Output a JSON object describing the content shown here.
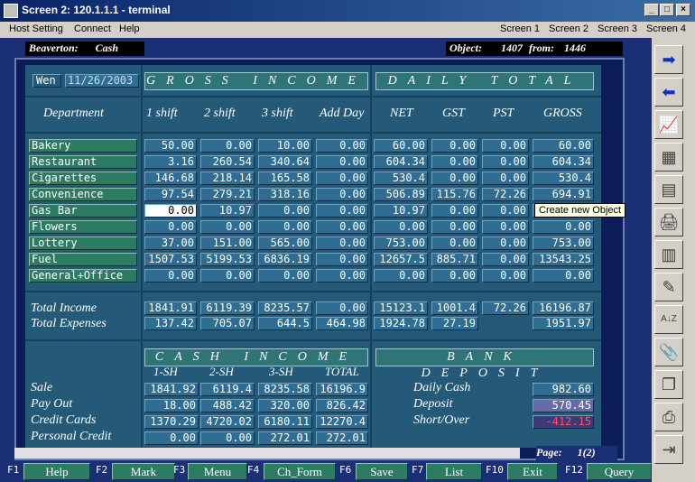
{
  "window": {
    "title": "Screen 2: 120.1.1.1 - terminal"
  },
  "menu": {
    "left": [
      "Host Setting",
      "Connect",
      "Help"
    ],
    "right": [
      "Screen 1",
      "Screen 2",
      "Screen 3",
      "Screen 4"
    ]
  },
  "header": {
    "location": "Beaverton:",
    "mode": "Cash",
    "object_label": "Object:",
    "object_id": "1407",
    "from_label": "from:",
    "from_total": "1446"
  },
  "date": {
    "day": "Wen",
    "value": "11/26/2003"
  },
  "banners": {
    "gross": "GROSS INCOME",
    "daily": "DAILY TOTAL",
    "cash": "CASH INCOME",
    "bank": "BANK DEPOSIT"
  },
  "columns": [
    "Department",
    "1 shift",
    "2 shift",
    "3 shift",
    "Add Day",
    "NET",
    "GST",
    "PST",
    "GROSS"
  ],
  "rows": [
    {
      "dept": "Bakery",
      "v": [
        "50.00",
        "0.00",
        "10.00",
        "0.00",
        "60.00",
        "0.00",
        "0.00",
        "60.00"
      ]
    },
    {
      "dept": "Restaurant",
      "v": [
        "3.16",
        "260.54",
        "340.64",
        "0.00",
        "604.34",
        "0.00",
        "0.00",
        "604.34"
      ]
    },
    {
      "dept": "Cigarettes",
      "v": [
        "146.68",
        "218.14",
        "165.58",
        "0.00",
        "530.4",
        "0.00",
        "0.00",
        "530.4"
      ]
    },
    {
      "dept": "Convenience",
      "v": [
        "97.54",
        "279.21",
        "318.16",
        "0.00",
        "506.89",
        "115.76",
        "72.26",
        "694.91"
      ]
    },
    {
      "dept": "Gas Bar",
      "v": [
        "0.00",
        "10.97",
        "0.00",
        "0.00",
        "10.97",
        "0.00",
        "0.00",
        ""
      ]
    },
    {
      "dept": "Flowers",
      "v": [
        "0.00",
        "0.00",
        "0.00",
        "0.00",
        "0.00",
        "0.00",
        "0.00",
        "0.00"
      ]
    },
    {
      "dept": "Lottery",
      "v": [
        "37.00",
        "151.00",
        "565.00",
        "0.00",
        "753.00",
        "0.00",
        "0.00",
        "753.00"
      ]
    },
    {
      "dept": "Fuel",
      "v": [
        "1507.53",
        "5199.53",
        "6836.19",
        "0.00",
        "12657.5",
        "885.71",
        "0.00",
        "13543.25"
      ]
    },
    {
      "dept": "General+Office",
      "v": [
        "0.00",
        "0.00",
        "0.00",
        "0.00",
        "0.00",
        "0.00",
        "0.00",
        "0.00"
      ]
    }
  ],
  "totals": {
    "income_label": "Total   Income",
    "income": [
      "1841.91",
      "6119.39",
      "8235.57",
      "0.00",
      "15123.1",
      "1001.4",
      "72.26",
      "16196.87"
    ],
    "expenses_label": "Total   Expenses",
    "expenses": [
      "137.42",
      "705.07",
      "644.5",
      "464.98",
      "1924.78",
      "27.19",
      "",
      "1951.97"
    ]
  },
  "cash": {
    "headers": [
      "1-SH",
      "2-SH",
      "3-SH",
      "TOTAL"
    ],
    "rows": [
      {
        "label": "Sale",
        "v": [
          "1841.92",
          "6119.4",
          "8235.58",
          "16196.9"
        ]
      },
      {
        "label": "Pay  Out",
        "v": [
          "18.00",
          "488.42",
          "320.00",
          "826.42"
        ]
      },
      {
        "label": "Credit   Cards",
        "v": [
          "1370.29",
          "4720.02",
          "6180.11",
          "12270.4"
        ]
      },
      {
        "label": "Personal   Credit",
        "v": [
          "0.00",
          "0.00",
          "272.01",
          "272.01"
        ]
      }
    ]
  },
  "bank": {
    "rows": [
      {
        "label": "Daily   Cash",
        "v": "982.60"
      },
      {
        "label": "Deposit",
        "v": "570.45"
      },
      {
        "label": "Short/Over",
        "v": "-412.15"
      }
    ]
  },
  "page": {
    "label": "Page:",
    "value": "1(2)"
  },
  "tooltip": "Create new Object",
  "fkeys": [
    {
      "num": "F1",
      "label": "Help"
    },
    {
      "num": "F2",
      "label": "Mark"
    },
    {
      "num": "F3",
      "label": "Menu"
    },
    {
      "num": "F4",
      "label": "Ch_Form"
    },
    {
      "num": "F6",
      "label": "Save"
    },
    {
      "num": "F7",
      "label": "List"
    },
    {
      "num": "F10",
      "label": "Exit"
    },
    {
      "num": "F12",
      "label": "Query"
    }
  ],
  "toolbar_icons": [
    "arrow-right-icon",
    "arrow-left-icon",
    "chart-icon",
    "report-icon",
    "new-object-icon",
    "print-icon",
    "calculator-icon",
    "eraser-icon",
    "sort-az-icon",
    "paperclip-icon",
    "copy-icon",
    "scanner-icon",
    "exit-door-icon"
  ],
  "colors": {
    "terminal_bg": "#1b2f74",
    "panel": "#245a78",
    "cell": "#2f6e92",
    "dept": "#2c7c64",
    "negative": "#ff5555"
  }
}
